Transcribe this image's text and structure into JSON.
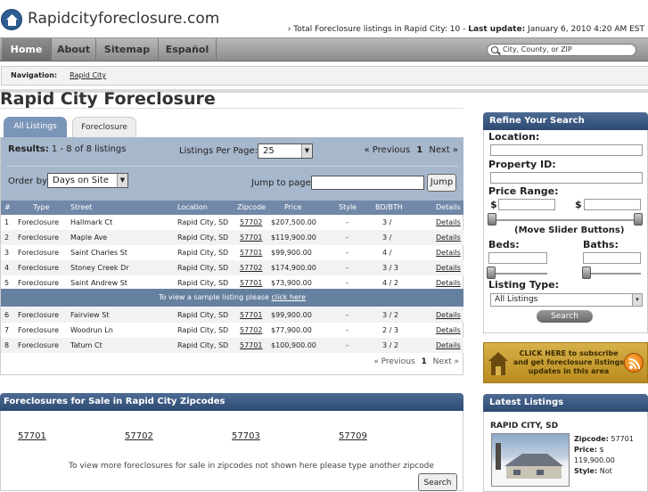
{
  "header": {
    "site_title": "Rapidcityforeclosure.com",
    "stats_prefix": "› Total Foreclosure listings in Rapid City: 10 - ",
    "stats_update_label": "Last update:",
    "stats_update_value": " January 6, 2010 4:20 AM EST"
  },
  "nav": {
    "items": [
      "Home",
      "About",
      "Sitemap",
      "Español"
    ],
    "search_placeholder": "City, County, or ZIP"
  },
  "breadcrumb": {
    "label": "Navigation:",
    "link": "Rapid City"
  },
  "page_title": "Rapid City Foreclosure",
  "tabs": [
    "All Listings",
    "Foreclosure"
  ],
  "results": {
    "label": "Results:",
    "text": " 1 - 8 of 8 listings",
    "per_page_label": "Listings Per Page:",
    "per_page_value": "25",
    "prev": "« Previous",
    "page": "1",
    "next": "Next »",
    "order_label": "Order by",
    "order_value": "Days on Site",
    "jump_label": "Jump to page",
    "jump_button": "Jump"
  },
  "table": {
    "headers": [
      "#",
      "Type",
      "Street",
      "Location",
      "Zipcode",
      "Price",
      "Style",
      "BD/BTH",
      "Details"
    ],
    "rows": [
      {
        "n": "1",
        "type": "Foreclosure",
        "street": "Hallmark Ct",
        "loc": "Rapid City, SD",
        "zip": "57702",
        "price": "$207,500.00",
        "style": "-",
        "bdbth": "3 /",
        "details": "Details"
      },
      {
        "n": "2",
        "type": "Foreclosure",
        "street": "Maple Ave",
        "loc": "Rapid City, SD",
        "zip": "57701",
        "price": "$119,900.00",
        "style": "-",
        "bdbth": "3 /",
        "details": "Details"
      },
      {
        "n": "3",
        "type": "Foreclosure",
        "street": "Saint Charles St",
        "loc": "Rapid City, SD",
        "zip": "57701",
        "price": "$99,900.00",
        "style": "-",
        "bdbth": "4 /",
        "details": "Details"
      },
      {
        "n": "4",
        "type": "Foreclosure",
        "street": "Stoney Creek Dr",
        "loc": "Rapid City, SD",
        "zip": "57702",
        "price": "$174,900.00",
        "style": "-",
        "bdbth": "3 / 3",
        "details": "Details"
      },
      {
        "n": "5",
        "type": "Foreclosure",
        "street": "Saint Andrew St",
        "loc": "Rapid City, SD",
        "zip": "57701",
        "price": "$73,900.00",
        "style": "-",
        "bdbth": "4 / 2",
        "details": "Details"
      },
      {
        "n": "6",
        "type": "Foreclosure",
        "street": "Fairview St",
        "loc": "Rapid City, SD",
        "zip": "57701",
        "price": "$99,900.00",
        "style": "-",
        "bdbth": "3 / 2",
        "details": "Details"
      },
      {
        "n": "7",
        "type": "Foreclosure",
        "street": "Woodrun Ln",
        "loc": "Rapid City, SD",
        "zip": "57702",
        "price": "$77,900.00",
        "style": "-",
        "bdbth": "2 / 3",
        "details": "Details"
      },
      {
        "n": "8",
        "type": "Foreclosure",
        "street": "Tatum Ct",
        "loc": "Rapid City, SD",
        "zip": "57701",
        "price": "$100,900.00",
        "style": "-",
        "bdbth": "3 / 2",
        "details": "Details"
      }
    ],
    "promo_text": "To view a sample listing please ",
    "promo_link": "click here"
  },
  "zipcodes": {
    "title": "Foreclosures for Sale in Rapid City Zipcodes",
    "codes": [
      "57701",
      "57702",
      "57703",
      "57709"
    ],
    "note": "To view more foreclosures for sale in zipcodes not shown here please type another zipcode",
    "search_button": "Search"
  },
  "refine": {
    "title": "Refine Your Search",
    "location_label": "Location:",
    "property_id_label": "Property ID:",
    "price_label": "Price Range:",
    "currency": "$",
    "slider_note": "(Move Slider Buttons)",
    "beds_label": "Beds:",
    "baths_label": "Baths:",
    "type_label": "Listing Type:",
    "type_value": "All Listings",
    "search_button": "Search"
  },
  "subscribe": {
    "text": "CLICK HERE to subscribe and get foreclosure listings updates in this area"
  },
  "latest": {
    "title": "Latest Listings",
    "city": "RAPID CITY, SD",
    "zip_label": "Zipcode:",
    "zip_value": " 57701",
    "price_label": "Price:",
    "price_value": " $ 119,900.00",
    "style_label": "Style:",
    "style_value": " Not"
  },
  "colors": {
    "accent": "#2d4a72",
    "table_header": "#7288a8",
    "results_bar": "#a7b7cc"
  }
}
